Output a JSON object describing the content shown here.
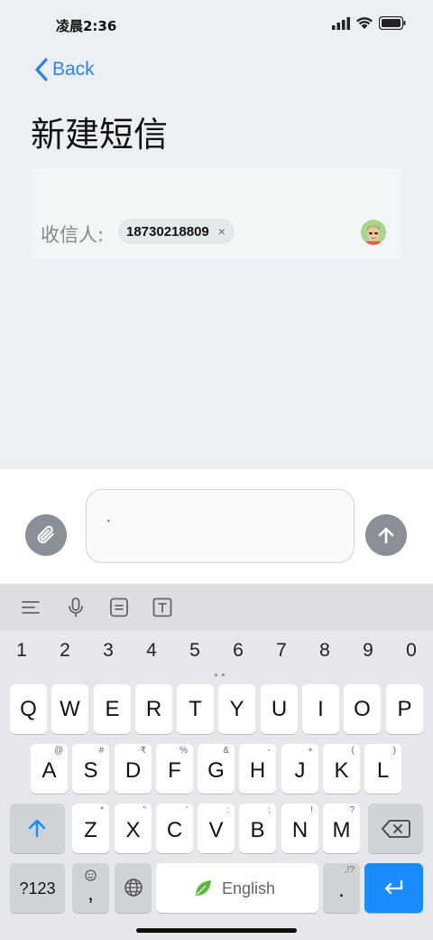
{
  "status": {
    "time": "凌晨2:36"
  },
  "nav": {
    "back_label": "Back"
  },
  "page": {
    "title": "新建短信"
  },
  "recipient": {
    "label": "收信人:",
    "chip_number": "18730218809",
    "chip_remove": "×"
  },
  "compose": {
    "message_text": "."
  },
  "keyboard": {
    "numbers": [
      "1",
      "2",
      "3",
      "4",
      "5",
      "6",
      "7",
      "8",
      "9",
      "0"
    ],
    "row1": [
      "Q",
      "W",
      "E",
      "R",
      "T",
      "Y",
      "U",
      "I",
      "O",
      "P"
    ],
    "row2": [
      "A",
      "S",
      "D",
      "F",
      "G",
      "H",
      "J",
      "K",
      "L"
    ],
    "row2_sub": [
      "@",
      "#",
      "₹",
      "%",
      "&",
      "-",
      "+",
      "(",
      ")"
    ],
    "row3": [
      "Z",
      "X",
      "C",
      "V",
      "B",
      "N",
      "M"
    ],
    "row3_sub": [
      "*",
      "\"",
      "'",
      ":",
      ";",
      "!",
      "?"
    ],
    "symbols_key": "?123",
    "comma_key": ",",
    "space_label": "English",
    "period_key": ".",
    "period_sub": ",!?",
    "accent_color": "#1a8cff"
  }
}
